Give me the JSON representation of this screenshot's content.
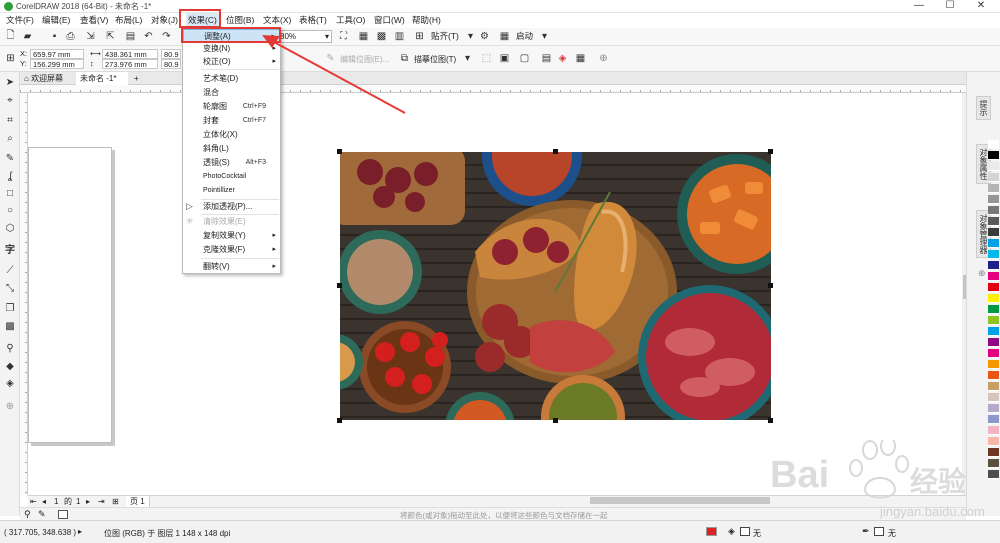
{
  "window": {
    "title": "CorelDRAW 2018 (64-Bit) - 未命名 -1*",
    "minimize": "—",
    "maximize": "☐",
    "close": "✕"
  },
  "menubar": {
    "items": [
      "文件(F)",
      "编辑(E)",
      "查看(V)",
      "布局(L)",
      "对象(J)",
      "效果(C)",
      "位图(B)",
      "文本(X)",
      "表格(T)",
      "工具(O)",
      "窗口(W)",
      "帮助(H)"
    ],
    "active_index": 5
  },
  "stdbar": {
    "zoom": "80%",
    "snap_label": "贴齐(T)",
    "launch_label": "启动"
  },
  "propbar": {
    "x": "659.97 mm",
    "y": "156.299 mm",
    "w": "438.361 mm",
    "h": "273.976 mm",
    "scale_w": "80.9",
    "scale_h": "80.9",
    "edit_bitmap": "编辑位图(E)...",
    "trace_bitmap": "描摹位图(T)"
  },
  "doctabs": {
    "welcome": "欢迎屏幕",
    "document": "未命名 -1*"
  },
  "dropdown": {
    "items": [
      {
        "label": "调整(A)",
        "shortcut": "",
        "arrow": true,
        "highlight": true
      },
      {
        "label": "变换(N)",
        "shortcut": "",
        "arrow": true
      },
      {
        "label": "校正(O)",
        "shortcut": "",
        "arrow": true
      },
      {
        "sep": true
      },
      {
        "label": "艺术笔(D)",
        "shortcut": ""
      },
      {
        "label": "混合",
        "shortcut": ""
      },
      {
        "label": "轮廓图",
        "shortcut": "Ctrl+F9"
      },
      {
        "label": "封套",
        "shortcut": "Ctrl+F7"
      },
      {
        "label": "立体化(X)",
        "shortcut": ""
      },
      {
        "label": "斜角(L)",
        "shortcut": ""
      },
      {
        "label": "透镜(S)",
        "shortcut": "Alt+F3"
      },
      {
        "label": "PhotoCocktail",
        "shortcut": ""
      },
      {
        "label": "Pointillizer",
        "shortcut": ""
      },
      {
        "sep": true
      },
      {
        "label": "添加透视(P)...",
        "shortcut": "",
        "icon": "▷"
      },
      {
        "sep": true
      },
      {
        "label": "清除效果(E)",
        "shortcut": "",
        "disabled": true,
        "icon": "✳"
      },
      {
        "label": "复制效果(Y)",
        "shortcut": "",
        "arrow": true
      },
      {
        "label": "克隆效果(F)",
        "shortcut": "",
        "arrow": true
      },
      {
        "sep": true
      },
      {
        "label": "翻转(V)",
        "shortcut": "",
        "arrow": true
      }
    ]
  },
  "rightdock": {
    "tabs": [
      "提示",
      "对象属性",
      "对象管理器"
    ]
  },
  "pagenav": {
    "current": "1",
    "of": "的",
    "total": "1",
    "page_tab": "页 1"
  },
  "colorbar": {
    "hint": "将颜色(或对象)拖动至此处，以便将这些颜色与文档存储在一起"
  },
  "statusbar": {
    "coords": "( 317.705, 348.638 )",
    "object_info": "位图 (RGB) 于 图层 1 148 x 148 dpi",
    "fill_none": "无",
    "outline_none": "无"
  },
  "palette": {
    "colors": [
      "#ffffff",
      "#000000",
      "#eaeaea",
      "#d4d4d4",
      "#b5b5b5",
      "#969696",
      "#777777",
      "#595959",
      "#3b3b3b",
      "#00a0e9",
      "#00b7ee",
      "#1d2088",
      "#e4007f",
      "#e60012",
      "#fff100",
      "#009944",
      "#8fc31f",
      "#00a0e9",
      "#920783",
      "#e4007f",
      "#f39800",
      "#ea5514",
      "#c9a063",
      "#d7c4bb",
      "#b5a9c9",
      "#8c97cb",
      "#f4b3c2",
      "#f6b7a9",
      "#6c3524",
      "#5b4f3f",
      "#4d4d4d"
    ]
  },
  "watermark": {
    "brand_line": "Bai",
    "brand_cn": "经验",
    "url": "jingyan.baidu.com"
  }
}
